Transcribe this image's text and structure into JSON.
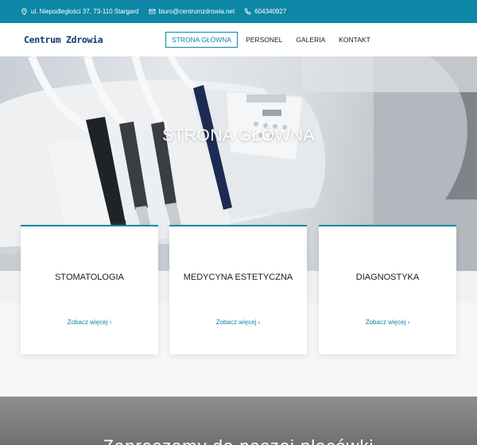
{
  "topbar": {
    "address": "ul. Niepodległości 37, 73-110 Stargard",
    "email": "biuro@centrumzdrowia.net",
    "phone": "604340927",
    "icons": [
      "location-icon",
      "mail-icon",
      "phone-icon"
    ]
  },
  "header": {
    "logo": "Centrum Zdrowia",
    "nav": [
      {
        "label": "STRONA GŁÓWNA",
        "active": true
      },
      {
        "label": "PERSONEL",
        "active": false
      },
      {
        "label": "GALERIA",
        "active": false
      },
      {
        "label": "KONTAKT",
        "active": false
      }
    ]
  },
  "hero": {
    "title": "STRONA GŁÓWNA"
  },
  "cards": [
    {
      "title": "STOMATOLOGIA",
      "link": "Zobacz więcej ›"
    },
    {
      "title": "MEDYCYNA ESTETYCZNA",
      "link": "Zobacz więcej ›"
    },
    {
      "title": "DIAGNOSTYKA",
      "link": "Zobacz więcej ›"
    }
  ],
  "teaser": {
    "text": "Zapraszamy do naszej placówki"
  },
  "colors": {
    "accent": "#0d87a5",
    "logo": "#0e3b6b",
    "text": "#1b1b1b"
  }
}
